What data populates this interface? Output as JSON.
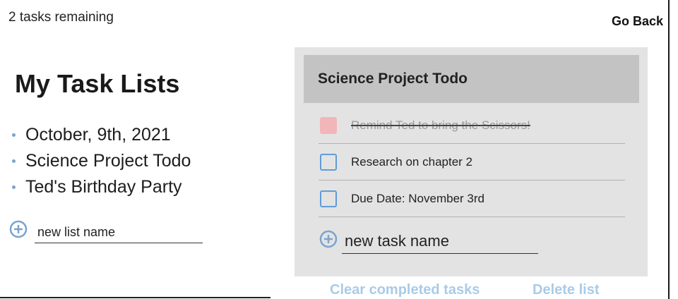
{
  "header": {
    "remaining_text": "2 tasks remaining",
    "go_back_label": "Go Back"
  },
  "sidebar": {
    "title": "My Task Lists",
    "lists": [
      {
        "label": "October, 9th, 2021"
      },
      {
        "label": "Science Project Todo"
      },
      {
        "label": "Ted's Birthday Party"
      }
    ],
    "new_list_placeholder": "new list name"
  },
  "panel": {
    "title": "Science Project Todo",
    "tasks": [
      {
        "label": "Remind Ted to bring the Scissors!",
        "completed": true
      },
      {
        "label": "Research on chapter 2",
        "completed": false
      },
      {
        "label": "Due Date: November 3rd",
        "completed": false
      }
    ],
    "new_task_placeholder": "new task name",
    "clear_completed_label": "Clear completed tasks",
    "delete_list_label": "Delete list"
  },
  "colors": {
    "accent": "#7aa4cd",
    "checkbox_border": "#5f9cd6",
    "completed_check": "#f2b6b8",
    "link": "#a9cbe8",
    "panel_bg": "#e3e3e3",
    "panel_header_bg": "#c3c3c3"
  },
  "icons": {
    "add_list": "plus-circle-icon",
    "add_task": "plus-circle-icon"
  }
}
